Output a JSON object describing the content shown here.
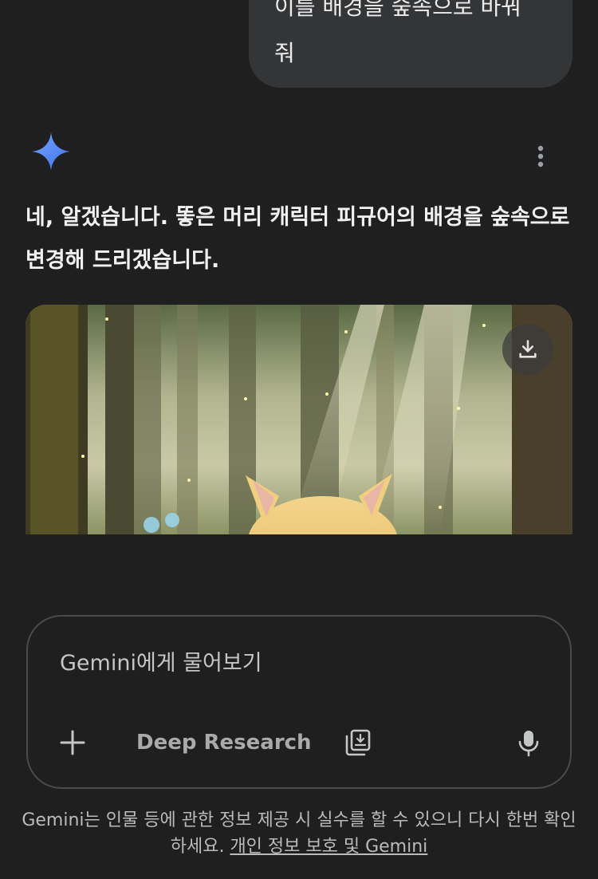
{
  "user_message": {
    "line1": "이를 배경을 숲속으로 바꿔",
    "line2": "줘"
  },
  "response": {
    "text": "네, 알겠습니다. 똫은 머리 캐릭터 피규어의 배경을 숲속으로 변경해 드리겠습니다."
  },
  "icons": {
    "assistant": "gemini-sparkle-icon",
    "more": "more-vert-icon",
    "download": "download-icon",
    "add": "plus-icon",
    "canvas": "canvas-icon",
    "mic": "mic-icon"
  },
  "input": {
    "placeholder": "Gemini에게 물어보기",
    "value": ""
  },
  "tools": {
    "deep_research": "Deep Research"
  },
  "disclaimer": {
    "text": "Gemini는 인물 등에 관한 정보 제공 시 실수를 할 수 있으니 다시 한번 확인하세요.",
    "link": "개인 정보 보호 및 Gemini"
  },
  "colors": {
    "background": "#1f1f1f",
    "bubble": "#333537",
    "sparkle": "#4c8df6"
  }
}
